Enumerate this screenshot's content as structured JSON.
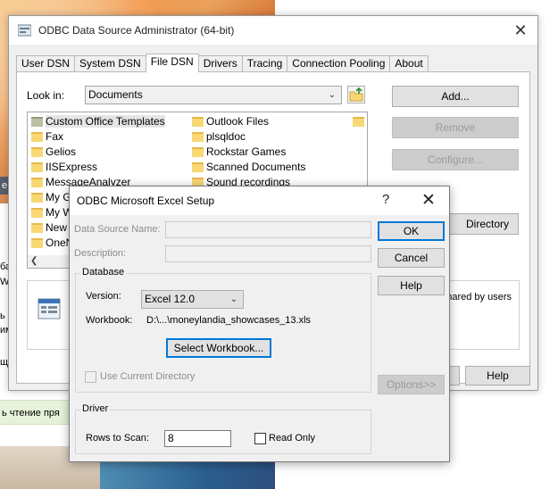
{
  "background": {
    "badge": "e",
    "text_fragments": [
      "ба",
      "Wi",
      "ь",
      "им",
      "щ"
    ],
    "green_text": "ь чтение пря"
  },
  "main_window": {
    "title": "ODBC Data Source Administrator (64-bit)",
    "close_glyph": "✕",
    "tabs": [
      {
        "label": "User DSN"
      },
      {
        "label": "System DSN"
      },
      {
        "label": "File DSN",
        "active": true
      },
      {
        "label": "Drivers"
      },
      {
        "label": "Tracing"
      },
      {
        "label": "Connection Pooling"
      },
      {
        "label": "About"
      }
    ],
    "look_in_label": "Look in:",
    "look_in_value": "Documents",
    "buttons": {
      "add": "Add...",
      "remove": "Remove",
      "configure": "Configure...",
      "set_directory": "Directory",
      "help": "Help"
    },
    "files_col1": [
      {
        "name": "Custom Office Templates",
        "selected": true,
        "grey": true
      },
      {
        "name": "Fax"
      },
      {
        "name": "Gelios"
      },
      {
        "name": "IISExpress"
      },
      {
        "name": "MessageAnalyzer"
      },
      {
        "name": "My Ga"
      },
      {
        "name": "My W"
      },
      {
        "name": "New f"
      },
      {
        "name": "OneN"
      }
    ],
    "files_col2": [
      {
        "name": "Outlook Files"
      },
      {
        "name": "plsqldoc"
      },
      {
        "name": "Rockstar Games"
      },
      {
        "name": "Scanned Documents"
      },
      {
        "name": "Sound recordings"
      }
    ],
    "info_text": "hared by users"
  },
  "dialog": {
    "title": "ODBC Microsoft Excel Setup",
    "help_glyph": "?",
    "close_glyph": "✕",
    "data_source_name_label": "Data Source Name:",
    "data_source_name_value": "",
    "description_label": "Description:",
    "description_value": "",
    "database_group": "Database",
    "version_label": "Version:",
    "version_value": "Excel 12.0",
    "workbook_label": "Workbook:",
    "workbook_value": "D:\\...\\moneylandia_showcases_13.xls",
    "select_workbook": "Select Workbook...",
    "use_current_directory": "Use Current Directory",
    "driver_group": "Driver",
    "rows_to_scan_label": "Rows to Scan:",
    "rows_to_scan_value": "8",
    "read_only_label": "Read Only",
    "buttons": {
      "ok": "OK",
      "cancel": "Cancel",
      "help": "Help",
      "options": "Options>>"
    }
  }
}
